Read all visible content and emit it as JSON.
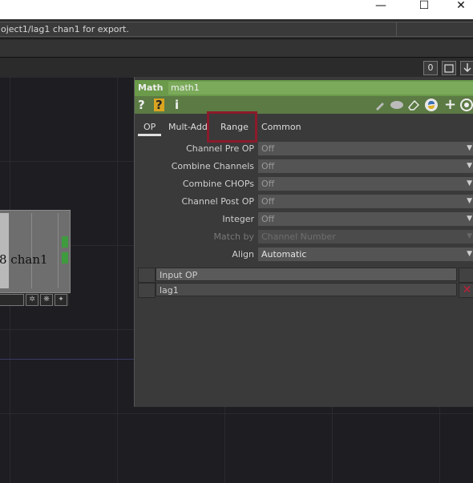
{
  "window": {
    "minimize_glyph": "—",
    "maximize_glyph": "☐",
    "close_glyph": "✕"
  },
  "status": {
    "message": "oject1/lag1 chan1 for export."
  },
  "toolbar": {
    "count": "0"
  },
  "node": {
    "label": "8 chan1"
  },
  "panel": {
    "op_type": "Math",
    "op_name": "math1",
    "header_color": "#6a9a4a",
    "icons": {
      "help": "?",
      "help_python": "?",
      "info": "i"
    },
    "tabs": [
      {
        "label": "OP",
        "active": true
      },
      {
        "label": "Mult-Add",
        "active": false
      },
      {
        "label": "Range",
        "active": false
      },
      {
        "label": "Common",
        "active": false
      }
    ],
    "params": [
      {
        "label": "Channel Pre OP",
        "value": "Off"
      },
      {
        "label": "Combine Channels",
        "value": "Off"
      },
      {
        "label": "Combine CHOPs",
        "value": "Off"
      },
      {
        "label": "Channel Post OP",
        "value": "Off"
      },
      {
        "label": "Integer",
        "value": "Off"
      },
      {
        "label": "Match by",
        "value": "Channel Number"
      },
      {
        "label": "Align",
        "value": "Automatic"
      }
    ],
    "input_table": {
      "header": "Input OP",
      "rows": [
        "lag1"
      ],
      "remove_glyph": "✕"
    },
    "highlight_color": "#8b1a2b"
  }
}
